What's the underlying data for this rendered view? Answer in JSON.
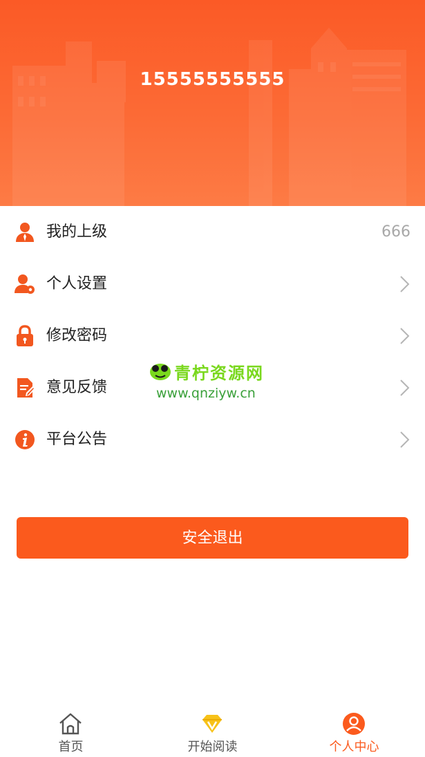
{
  "header": {
    "phone": "15555555555"
  },
  "menu": {
    "items": [
      {
        "label": "我的上级",
        "value": "666",
        "icon": "person-icon"
      },
      {
        "label": "个人设置",
        "icon": "user-settings-icon"
      },
      {
        "label": "修改密码",
        "icon": "lock-icon"
      },
      {
        "label": "意见反馈",
        "icon": "edit-document-icon"
      },
      {
        "label": "平台公告",
        "icon": "info-icon"
      }
    ]
  },
  "watermark": {
    "brand": "青柠资源网",
    "url": "www.qnziyw.cn"
  },
  "logout": {
    "label": "安全退出"
  },
  "tabbar": {
    "tabs": [
      {
        "label": "首页",
        "icon": "home-icon"
      },
      {
        "label": "开始阅读",
        "icon": "diamond-icon"
      },
      {
        "label": "个人中心",
        "icon": "profile-icon",
        "active": true
      }
    ]
  },
  "colors": {
    "accent": "#fb5a1d",
    "icon": "#f2571f",
    "chevron": "#b5b5b5"
  }
}
